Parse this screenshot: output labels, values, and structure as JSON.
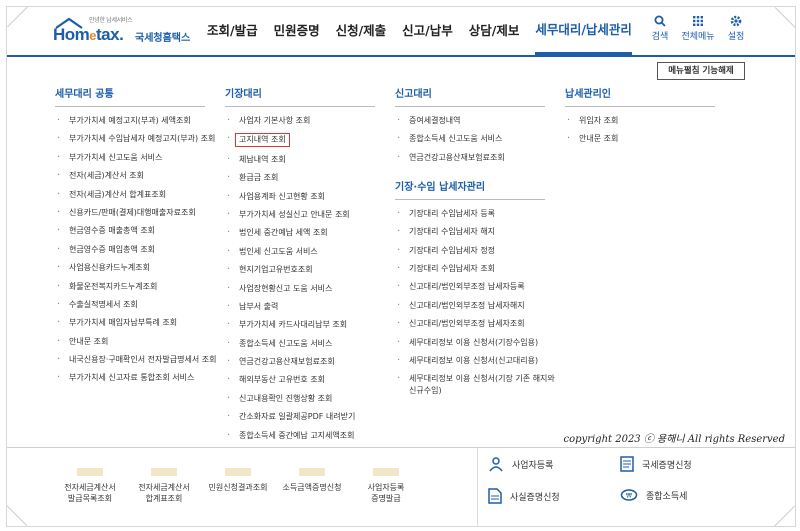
{
  "header": {
    "logo_tag": "안녕한 납세서비스",
    "logo_text_a": "Hom",
    "logo_text_e": "e",
    "logo_text_b": "tax.",
    "logo_sub": "국세청홈택스",
    "nav": [
      "조회/발급",
      "민원증명",
      "신청/제출",
      "신고/납부",
      "상담/제보",
      "세무대리/납세관리"
    ],
    "tools": [
      {
        "label": "검색",
        "icon": "search-icon"
      },
      {
        "label": "전체메뉴",
        "icon": "grid-icon"
      },
      {
        "label": "설정",
        "icon": "gear-icon"
      }
    ]
  },
  "menu": {
    "release_label": "메뉴펼침 기능해제",
    "col1": {
      "title": "세무대리 공통",
      "items": [
        "부가가치세 예정고지(부과) 세액조회",
        "부가가치세 수임납세자 예정고지(부과) 조회",
        "부가가치세 신고도움 서비스",
        "전자(세금)계산서 조회",
        "전자(세금)계산서 합계표조회",
        "신용카드/판매(결제)대행매출자료조회",
        "현금영수증 매출총액 조회",
        "현금영수증 매입총액 조회",
        "사업용신용카드누계조회",
        "화물운전복지카드누계조회",
        "수출실적명세서 조회",
        "부가가치세 매입자납부특례 조회",
        "안내문 조회",
        "내국신용장·구매확인서 전자발급명세서 조회",
        "부가가치세 신고자료 통합조회 서비스"
      ]
    },
    "col2": {
      "title": "기장대리",
      "items": [
        "사업자 기본사항 조회",
        "고지내역 조회",
        "체납내역 조회",
        "환급금 조회",
        "사업용계좌 신고현황 조회",
        "부가가치세 성실신고 안내문 조회",
        "법인세 중간예납 세액 조회",
        "법인세 신고도움 서비스",
        "현지기업고유번호조회",
        "사업장현황신고 도움 서비스",
        "납부서 출력",
        "부가가치세 카드사대리납부 조회",
        "종합소득세 신고도움 서비스",
        "연금건강고용산재보험료조회",
        "해외부동산 고유번호 조회",
        "신고내용확인 진행상황 조회",
        "간소화자료 일괄제공PDF 내려받기",
        "종합소득세 중간예납 고지세액조회"
      ],
      "highlight_index": 1
    },
    "col3": {
      "title": "신고대리",
      "items": [
        "증여세결정내역",
        "종합소득세 신고도움 서비스",
        "연금건강고용산재보험료조회"
      ],
      "sub_title": "기장·수임 납세자관리",
      "sub_items": [
        "기장대리 수임납세자 등록",
        "기장대리 수임납세자 해지",
        "기장대리 수임납세자 정정",
        "기장대리 수임납세자 조회",
        "신고대리/법인외부조정 납세자등록",
        "신고대리/법인외부조정 납세자해지",
        "신고대리/법인외부조정 납세자조회",
        "세무대리정보 이용 신청서(기장수임용)",
        "세무대리정보 이용 신청서(신고대리용)",
        "세무대리정보 이용 신청서(기장 기존 해지와 신규수임)"
      ]
    },
    "col4": {
      "title": "납세관리인",
      "items": [
        "위임자 조회",
        "안내문 조회"
      ]
    },
    "copyright": "copyright 2023 ⓒ 용해니 All rights Reserved"
  },
  "below": {
    "quick": [
      [
        "전자세금계산서",
        "발급목록조회"
      ],
      [
        "전자세금계산서",
        "합계표조회"
      ],
      [
        "민원신청결과조회",
        ""
      ],
      [
        "소득금액증명신청",
        ""
      ],
      [
        "사업자등록",
        "증명발급"
      ]
    ],
    "links": [
      "사업자등록",
      "국세증명신청",
      "사실증명신청",
      "종합소득세"
    ]
  },
  "colors": {
    "brand": "#1c5ea9",
    "highlight": "#d23a3a",
    "accent": "#e5892d"
  }
}
